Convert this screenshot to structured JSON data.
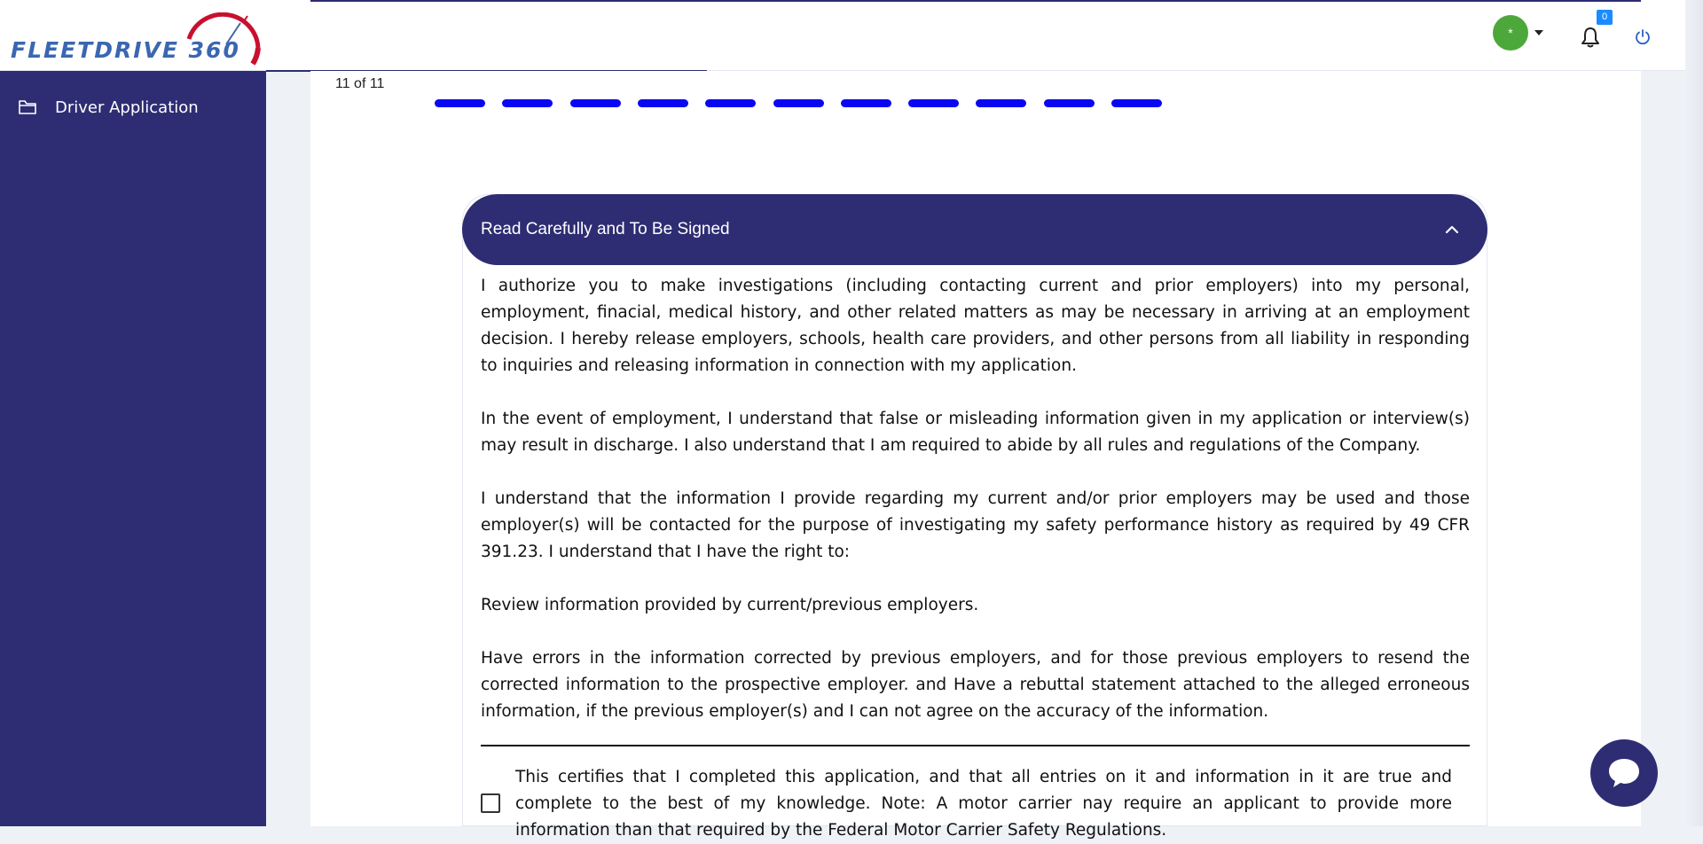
{
  "brand": {
    "logo_text": "FLEETDRIVE 360",
    "color_primary": "#2e2d73",
    "color_accent": "#0a06f2"
  },
  "header": {
    "avatar_initial": "*",
    "notification_count": "0"
  },
  "sidebar": {
    "items": [
      {
        "label": "Driver Application",
        "icon": "folder-icon"
      }
    ]
  },
  "form": {
    "step_label": "11 of 11",
    "total_steps": 11,
    "current_step": 11
  },
  "section": {
    "title": "Read Carefully and To Be Signed",
    "paragraphs": [
      "I authorize you to make investigations (including contacting current and prior employers) into my personal, employment, finacial, medical history, and other related matters as may be necessary in arriving at an employment decision. I hereby release employers, schools, health care providers, and other persons from all liability in responding to inquiries and releasing information in connection with my application.",
      "In the event of employment, I understand that false or misleading information given in my application or interview(s) may result in discharge. I also understand that I am required to abide by all rules and regulations of the Company.",
      "I understand that the information I provide regarding my current and/or prior employers may be used and those employer(s) will be contacted for the purpose of investigating my safety performance history as required by 49 CFR 391.23. I understand that I have the right to:",
      "Review information provided by current/previous employers.",
      "Have errors in the information corrected by previous employers, and for those previous employers to resend the corrected information to the prospective employer. and Have a rebuttal statement attached to the alleged erroneous information, if the previous employer(s) and I can not agree on the accuracy of the information."
    ],
    "certification": "This certifies that I completed this application, and that all entries on it and information in it are true and complete to the best of my knowledge. Note: A motor carrier nay require an applicant to provide more information than that required by the Federal Motor Carrier Safety Regulations."
  }
}
